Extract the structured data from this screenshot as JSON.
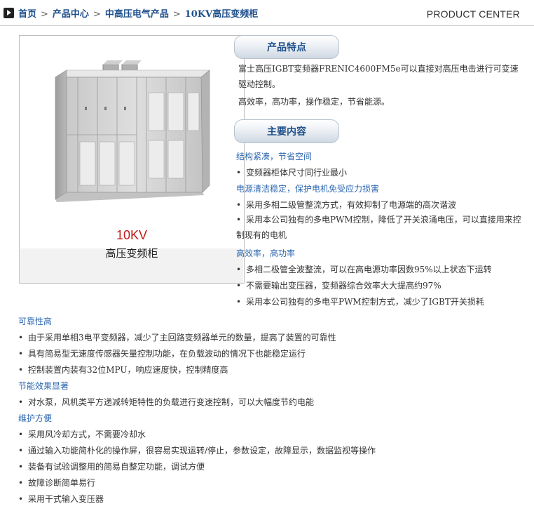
{
  "breadcrumb": {
    "items": [
      "首页",
      "产品中心",
      "中高压电气产品",
      "10KV高压变频柜"
    ],
    "title_en": "PRODUCT CENTER"
  },
  "product": {
    "image_alt": "高压变频柜柜体",
    "model": "10KV",
    "name": "高压变频柜"
  },
  "features": {
    "tab_label": "产品特点",
    "paragraphs": [
      "富士高压IGBT变频器FRENIC4600FM5e可以直接对高压电击进行可变速驱动控制。",
      "高效率，高功率，操作稳定，节省能源。"
    ]
  },
  "main_content": {
    "tab_label": "主要内容",
    "sections": [
      {
        "heading": "结构紧凑，节省空间",
        "items": [
          "变频器柜体尺寸同行业最小"
        ]
      },
      {
        "heading": "电源清洁稳定，保护电机免受应力损害",
        "items": [
          "采用多相二级管整流方式，有效抑制了电源端的高次谐波",
          "采用本公司独有的多电PWM控制，降低了开关浪涌电压，可以直接用来控制现有的电机"
        ]
      },
      {
        "heading": "高效率，高功率",
        "items": [
          "多相二极管全波整流，可以在高电源功率因数95%以上状态下运转",
          "不需要输出变压器，变频器综合效率大大提高约97%",
          "采用本公司独有的多电平PWM控制方式，减少了IGBT开关损耗"
        ]
      },
      {
        "heading": "可靠性高",
        "items": [
          "由于采用单相3电平变频器，减少了主回路变频器单元的数量，提高了装置的可靠性",
          "具有简易型无速度传感器矢量控制功能，在负载波动的情况下也能稳定运行",
          "控制装置内装有32位MPU，响应速度快，控制精度高"
        ]
      },
      {
        "heading": "节能效果显著",
        "items": [
          "对水泵，风机类平方递减转矩特性的负载进行变速控制，可以大幅度节约电能"
        ]
      },
      {
        "heading": "维护方便",
        "items": [
          "采用风冷却方式，不需要冷却水",
          "通过输入功能简朴化的操作屏，很容易实现运转/停止，参数设定，故障显示，数据监视等操作",
          "装备有试验调整用的简易自整定功能，调试方便",
          "故障诊断简单易行",
          "采用干式输入变压器"
        ]
      }
    ]
  },
  "colors": {
    "link": "#1d4f8c",
    "heading": "#2c67b0",
    "model": "#c11b17"
  }
}
